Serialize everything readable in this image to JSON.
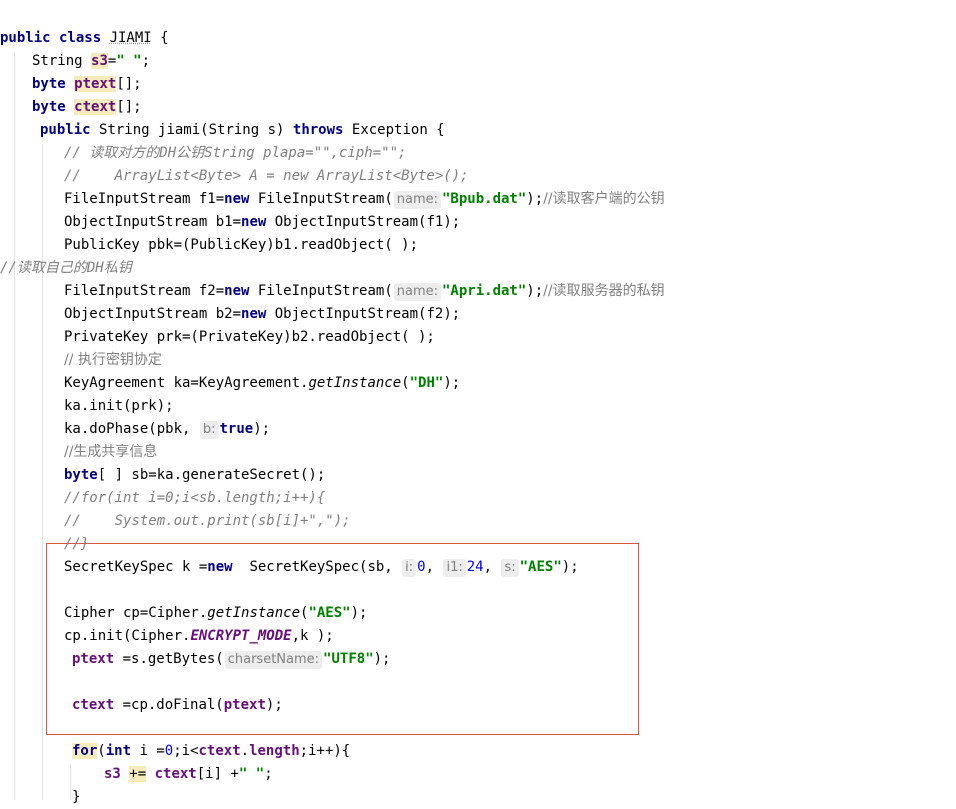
{
  "code": {
    "class_decl": {
      "kw": "public class ",
      "name": "JIAMI",
      "rest": " {"
    },
    "field_s3": {
      "type": "String ",
      "name": "s3",
      "eq": "=",
      "val": "\" \"",
      "end": ";"
    },
    "field_ptext": {
      "type": "byte ",
      "name": "ptext",
      "end": "[];"
    },
    "field_ctext": {
      "type": "byte ",
      "name": "ctext",
      "end": "[];"
    },
    "method_decl": {
      "kw": "public ",
      "sig": "String jiami(String s) ",
      "throws": "throws",
      "rest": " Exception {"
    },
    "comment1": "// 读取对方的DH公钥String plapa=\"\",ciph=\"\";",
    "comment2": "//    ArrayList<Byte> A = new ArrayList<Byte>();",
    "line_f1": {
      "a": "FileInputStream f1=",
      "new": "new",
      "b": " FileInputStream(",
      "hint": "name:",
      "str": "\"Bpub.dat\"",
      "c": ");",
      "cm": "//读取客户端的公钥"
    },
    "line_b1": {
      "a": "ObjectInputStream b1=",
      "new": "new",
      "b": " ObjectInputStream(f1);"
    },
    "line_pbk": "PublicKey pbk=(PublicKey)b1.readObject( );",
    "comment3": "//读取自己的DH私钥",
    "line_f2": {
      "a": "FileInputStream f2=",
      "new": "new",
      "b": " FileInputStream(",
      "hint": "name:",
      "str": "\"Apri.dat\"",
      "c": ");",
      "cm": "//读取服务器的私钥"
    },
    "line_b2": {
      "a": "ObjectInputStream b2=",
      "new": "new",
      "b": " ObjectInputStream(f2);"
    },
    "line_prk": "PrivateKey prk=(PrivateKey)b2.readObject( );",
    "comment4": "// 执行密钥协定",
    "line_ka": {
      "a": "KeyAgreement ka=KeyAgreement.",
      "m": "getInstance",
      "b": "(",
      "str": "\"DH\"",
      "c": ");"
    },
    "line_init": "ka.init(prk);",
    "line_dophase": {
      "a": "ka.doPhase(pbk, ",
      "hint": "b:",
      "kw": "true",
      "c": ");"
    },
    "comment5": "//生成共享信息",
    "line_sb": {
      "kw": "byte",
      "a": "[ ] sb=ka.generateSecret();"
    },
    "comment6": "//for(int i=0;i<sb.length;i++){",
    "comment7": "//    System.out.print(sb[i]+\",\");",
    "comment8": "//}",
    "line_k": {
      "a": "SecretKeySpec k =",
      "new": "new",
      "b": "  SecretKeySpec(sb, ",
      "h1": "i:",
      "n1": "0",
      "sep1": ", ",
      "h2": "i1:",
      "n2": "24",
      "sep2": ", ",
      "h3": "s:",
      "str": "\"AES\"",
      "c": ");"
    },
    "line_cp": {
      "a": "Cipher cp=Cipher.",
      "m": "getInstance",
      "b": "(",
      "str": "\"AES\"",
      "c": ");"
    },
    "line_cpinit": {
      "a": "cp.init(Cipher.",
      "const": "ENCRYPT_MODE",
      "b": ",k );"
    },
    "line_ptext": {
      "fld": "ptext",
      "a": " =s.getBytes(",
      "hint": "charsetName:",
      "str": "\"UTF8\"",
      "c": ");"
    },
    "line_ctext": {
      "fld": "ctext",
      "a": " =cp.doFinal(",
      "fld2": "ptext",
      "c": ");"
    },
    "line_for": {
      "kw": "for",
      "a": "(",
      "kw2": "int",
      "b": " i =",
      "n": "0",
      "c": ";i<",
      "fld": "ctext",
      "d": ".",
      "fld2": "length",
      "e": ";i++){"
    },
    "line_s3": {
      "fld": "s3",
      "sp": " ",
      "op": "+=",
      "sp2": " ",
      "fld2": "ctext",
      "a": "[i] +",
      "str": "\" \"",
      "c": ";"
    },
    "line_close": "}"
  }
}
